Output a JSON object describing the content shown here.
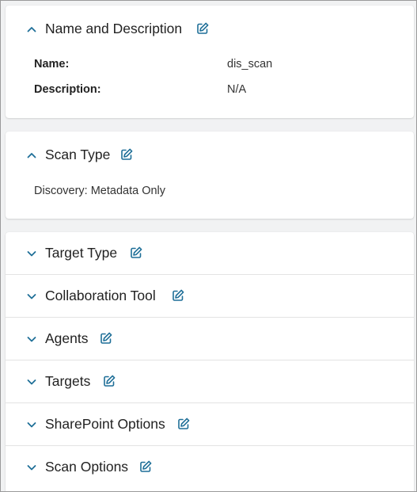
{
  "sections": {
    "name_description": {
      "title": "Name and Description",
      "fields": [
        {
          "label": "Name:",
          "value": "dis_scan"
        },
        {
          "label": "Description:",
          "value": "N/A"
        }
      ]
    },
    "scan_type": {
      "title": "Scan Type",
      "value": "Discovery: Metadata Only"
    },
    "collapsed": [
      {
        "title": "Target Type"
      },
      {
        "title": "Collaboration Tool"
      },
      {
        "title": "Agents"
      },
      {
        "title": "Targets"
      },
      {
        "title": "SharePoint Options"
      },
      {
        "title": "Scan Options"
      }
    ]
  },
  "icons": {
    "expanded": "chevron-up-icon",
    "collapsed": "chevron-down-icon",
    "edit": "edit-icon"
  },
  "colors": {
    "accent": "#1f6f98",
    "background": "#f1f2f3",
    "card": "#ffffff"
  }
}
